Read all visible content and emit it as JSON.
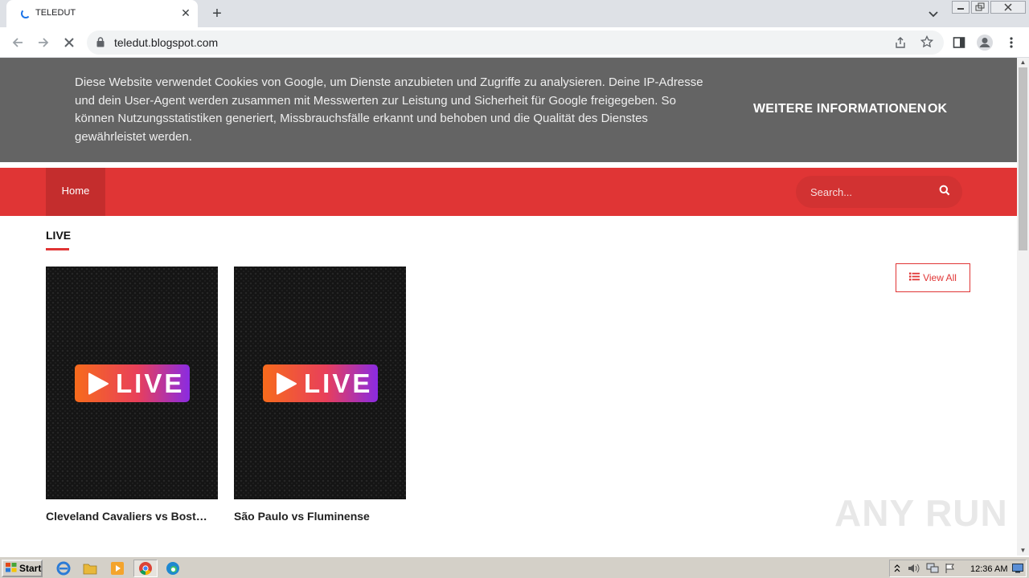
{
  "browser": {
    "tab_title": "TELEDUT",
    "tab_close": "✕",
    "new_tab": "+",
    "url": "teledut.blogspot.com"
  },
  "cookie": {
    "text": "Diese Website verwendet Cookies von Google, um Dienste anzubieten und Zugriffe zu analysieren. Deine IP-Adresse und dein User-Agent werden zusammen mit Messwerten zur Leistung und Sicherheit für Google freigegeben. So können Nutzungsstatistiken generiert, Missbrauchsfälle erkannt und behoben und die Qualität des Dienstes gewährleistet werden.",
    "more_label": "WEITERE INFORMATIONEN",
    "ok_label": "OK"
  },
  "nav": {
    "home_label": "Home",
    "search_placeholder": "Search..."
  },
  "section": {
    "title": "LIVE",
    "view_all_label": "View All"
  },
  "cards": [
    {
      "badge": "LIVE",
      "title": "Cleveland Cavaliers vs Boston Celtics"
    },
    {
      "badge": "LIVE",
      "title": "São Paulo vs Fluminense"
    }
  ],
  "watermark": "ANY RUN",
  "taskbar": {
    "start_label": "Start",
    "clock": "12:36 AM"
  },
  "colors": {
    "accent": "#e03535",
    "cookie_bg": "#646464"
  }
}
